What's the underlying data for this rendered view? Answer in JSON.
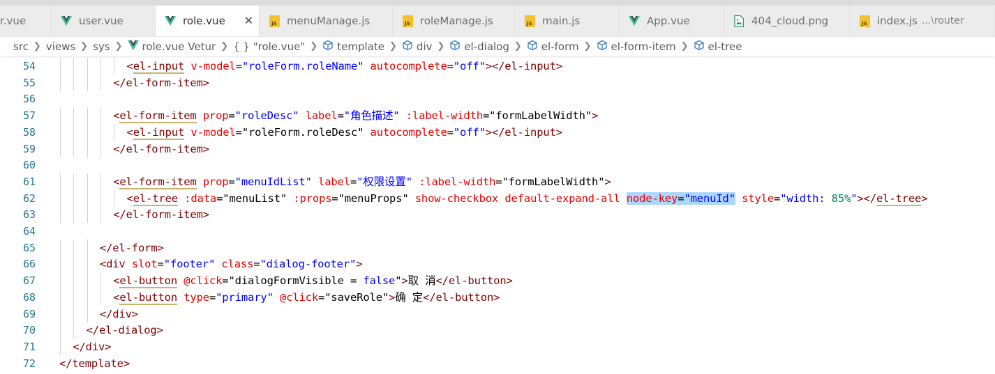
{
  "tabs": [
    {
      "label": "r.vue",
      "icon": "none",
      "active": false
    },
    {
      "label": "user.vue",
      "icon": "vue-icon",
      "active": false
    },
    {
      "label": "role.vue",
      "icon": "vue-icon",
      "active": true
    },
    {
      "label": "menuManage.js",
      "icon": "js-icon",
      "active": false
    },
    {
      "label": "roleManage.js",
      "icon": "js-icon",
      "active": false
    },
    {
      "label": "main.js",
      "icon": "js-icon",
      "active": false
    },
    {
      "label": "App.vue",
      "icon": "vue-icon",
      "active": false
    },
    {
      "label": "404_cloud.png",
      "icon": "image-icon",
      "active": false
    },
    {
      "label": "index.js",
      "icon": "js-icon",
      "desc": "...\\router",
      "active": false
    }
  ],
  "close_glyph": "✕",
  "js_badge": "JS",
  "breadcrumb": [
    "src",
    "views",
    "sys",
    "role.vue",
    "Vetur",
    "{ } \"role.vue\"",
    "template",
    "div",
    "el-dialog",
    "el-form",
    "el-form-item",
    "el-tree"
  ],
  "colors": {
    "tag": "#800000",
    "attr": "#e50000",
    "string": "#0000ff",
    "number": "#098658",
    "line_number": "#237893",
    "selection": "#add6ff",
    "vue": "#41b883",
    "js": "#f2c12e"
  },
  "code_lines": [
    {
      "n": "54",
      "indent": 5,
      "tokens": [
        [
          "tag",
          "<"
        ],
        [
          "tagu",
          "el-input"
        ],
        [
          "t",
          " "
        ],
        [
          "attr",
          "v-model"
        ],
        [
          "t",
          "="
        ],
        [
          "str",
          "\"roleForm.roleName\""
        ],
        [
          "t",
          " "
        ],
        [
          "attr",
          "autocomplete"
        ],
        [
          "t",
          "="
        ],
        [
          "str",
          "\"off\""
        ],
        [
          "tag",
          "></el-input>"
        ]
      ]
    },
    {
      "n": "55",
      "indent": 4,
      "tokens": [
        [
          "tag",
          "</el-form-item>"
        ]
      ]
    },
    {
      "n": "56",
      "indent": 0,
      "tokens": []
    },
    {
      "n": "57",
      "indent": 4,
      "tokens": [
        [
          "tag",
          "<"
        ],
        [
          "tagu",
          "el-form-item"
        ],
        [
          "t",
          " "
        ],
        [
          "attr",
          "prop"
        ],
        [
          "t",
          "="
        ],
        [
          "str",
          "\"roleDesc\""
        ],
        [
          "t",
          " "
        ],
        [
          "attr",
          "label"
        ],
        [
          "t",
          "="
        ],
        [
          "str",
          "\"角色描述\""
        ],
        [
          "t",
          " "
        ],
        [
          "attr",
          ":label-width"
        ],
        [
          "t",
          "="
        ],
        [
          "t",
          "\"formLabelWidth\""
        ],
        [
          "tag",
          ">"
        ]
      ]
    },
    {
      "n": "58",
      "indent": 5,
      "tokens": [
        [
          "tag",
          "<"
        ],
        [
          "tagu",
          "el-input"
        ],
        [
          "t",
          " "
        ],
        [
          "attr",
          "v-model"
        ],
        [
          "t",
          "="
        ],
        [
          "t",
          "\"roleForm.roleDesc\""
        ],
        [
          "t",
          " "
        ],
        [
          "attr",
          "autocomplete"
        ],
        [
          "t",
          "="
        ],
        [
          "str",
          "\"off\""
        ],
        [
          "tag",
          "></el-input>"
        ]
      ]
    },
    {
      "n": "59",
      "indent": 4,
      "tokens": [
        [
          "tag",
          "</el-form-item>"
        ]
      ]
    },
    {
      "n": "60",
      "indent": 0,
      "tokens": []
    },
    {
      "n": "61",
      "indent": 4,
      "tokens": [
        [
          "tag",
          "<"
        ],
        [
          "tagu",
          "el-form-item"
        ],
        [
          "t",
          " "
        ],
        [
          "attr",
          "prop"
        ],
        [
          "t",
          "="
        ],
        [
          "str",
          "\"menuIdList\""
        ],
        [
          "t",
          " "
        ],
        [
          "attr",
          "label"
        ],
        [
          "t",
          "="
        ],
        [
          "str",
          "\"权限设置\""
        ],
        [
          "t",
          " "
        ],
        [
          "attr",
          ":label-width"
        ],
        [
          "t",
          "="
        ],
        [
          "t",
          "\"formLabelWidth\""
        ],
        [
          "tag",
          ">"
        ]
      ]
    },
    {
      "n": "62",
      "indent": 5,
      "tokens": [
        [
          "tag",
          "<"
        ],
        [
          "tagu",
          "el-tree"
        ],
        [
          "t",
          " "
        ],
        [
          "attr",
          ":data"
        ],
        [
          "t",
          "="
        ],
        [
          "t",
          "\"menuList\""
        ],
        [
          "t",
          " "
        ],
        [
          "attr",
          ":props"
        ],
        [
          "t",
          "="
        ],
        [
          "t",
          "\"menuProps\""
        ],
        [
          "t",
          " "
        ],
        [
          "attr",
          "show-checkbox"
        ],
        [
          "t",
          " "
        ],
        [
          "attr",
          "default-expand-all"
        ],
        [
          "t",
          " "
        ],
        [
          "attrhl",
          "node-key"
        ],
        [
          "thl",
          "="
        ],
        [
          "strhl",
          "\"menuId\""
        ],
        [
          "t",
          " "
        ],
        [
          "attr",
          "style"
        ],
        [
          "t",
          "="
        ],
        [
          "str",
          "\"width: "
        ],
        [
          "num",
          "85%"
        ],
        [
          "str",
          "\""
        ],
        [
          "tag",
          "></"
        ],
        [
          "tagu",
          "el-tree"
        ],
        [
          "tag",
          ">"
        ]
      ]
    },
    {
      "n": "63",
      "indent": 4,
      "tokens": [
        [
          "tag",
          "</el-form-item>"
        ]
      ]
    },
    {
      "n": "64",
      "indent": 0,
      "tokens": []
    },
    {
      "n": "65",
      "indent": 3,
      "tokens": [
        [
          "tag",
          "</el-form>"
        ]
      ]
    },
    {
      "n": "66",
      "indent": 3,
      "tokens": [
        [
          "tag",
          "<div"
        ],
        [
          "t",
          " "
        ],
        [
          "attr",
          "slot"
        ],
        [
          "t",
          "="
        ],
        [
          "str",
          "\"footer\""
        ],
        [
          "t",
          " "
        ],
        [
          "attr",
          "class"
        ],
        [
          "t",
          "="
        ],
        [
          "str",
          "\"dialog-footer\""
        ],
        [
          "tag",
          ">"
        ]
      ]
    },
    {
      "n": "67",
      "indent": 4,
      "tokens": [
        [
          "tag",
          "<"
        ],
        [
          "tagu",
          "el-button"
        ],
        [
          "t",
          " "
        ],
        [
          "attr",
          "@click"
        ],
        [
          "t",
          "="
        ],
        [
          "t",
          "\"dialogFormVisible = "
        ],
        [
          "str",
          "false"
        ],
        [
          "t",
          "\""
        ],
        [
          "tag",
          ">"
        ],
        [
          "t",
          "取 消"
        ],
        [
          "tag",
          "</el-button>"
        ]
      ]
    },
    {
      "n": "68",
      "indent": 4,
      "tokens": [
        [
          "tag",
          "<"
        ],
        [
          "tagu",
          "el-button"
        ],
        [
          "t",
          " "
        ],
        [
          "attr",
          "type"
        ],
        [
          "t",
          "="
        ],
        [
          "str",
          "\"primary\""
        ],
        [
          "t",
          " "
        ],
        [
          "attr",
          "@click"
        ],
        [
          "t",
          "="
        ],
        [
          "t",
          "\"saveRole\""
        ],
        [
          "tag",
          ">"
        ],
        [
          "t",
          "确 定"
        ],
        [
          "tag",
          "</el-button>"
        ]
      ]
    },
    {
      "n": "69",
      "indent": 3,
      "tokens": [
        [
          "tag",
          "</div>"
        ]
      ]
    },
    {
      "n": "70",
      "indent": 2,
      "tokens": [
        [
          "tag",
          "</el-dialog>"
        ]
      ]
    },
    {
      "n": "71",
      "indent": 1,
      "tokens": [
        [
          "tag",
          "</div>"
        ]
      ]
    },
    {
      "n": "72",
      "indent": 0,
      "tokens": [
        [
          "tag",
          "</template>"
        ]
      ]
    }
  ]
}
